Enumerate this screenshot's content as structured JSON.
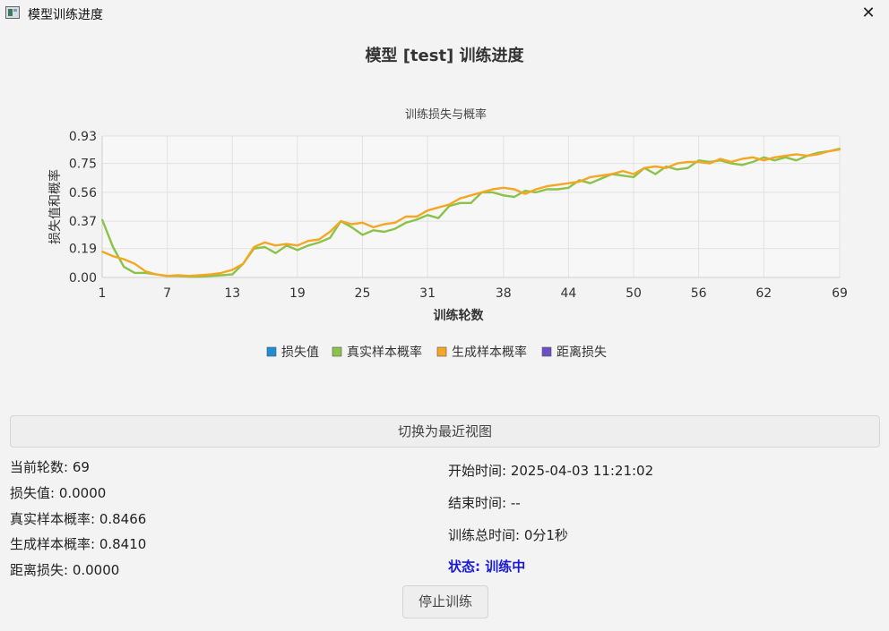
{
  "window": {
    "title": "模型训练进度",
    "close_symbol": "✕"
  },
  "heading": "模型 [test] 训练进度",
  "chart_data": {
    "type": "line",
    "title": "训练损失与概率",
    "xlabel": "训练轮数",
    "ylabel": "损失值和概率",
    "xlim": [
      1,
      69
    ],
    "ylim": [
      0,
      0.93
    ],
    "x_ticks": [
      1,
      7,
      13,
      19,
      25,
      31,
      38,
      44,
      50,
      56,
      62,
      69
    ],
    "y_ticks": [
      0.0,
      0.19,
      0.37,
      0.56,
      0.75,
      0.93
    ],
    "y_tick_labels": [
      "0.00",
      "0.19",
      "0.37",
      "0.56",
      "0.75",
      "0.93"
    ],
    "grid": true,
    "legend_position": "bottom",
    "series": [
      {
        "name": "损失值",
        "color": "#1f8dd6",
        "values": []
      },
      {
        "name": "真实样本概率",
        "color": "#8bc34a",
        "values": [
          0.38,
          0.2,
          0.07,
          0.03,
          0.03,
          0.02,
          0.01,
          0.01,
          0.005,
          0.005,
          0.01,
          0.015,
          0.02,
          0.09,
          0.19,
          0.2,
          0.16,
          0.21,
          0.18,
          0.21,
          0.23,
          0.26,
          0.37,
          0.33,
          0.28,
          0.31,
          0.3,
          0.32,
          0.36,
          0.38,
          0.41,
          0.39,
          0.47,
          0.49,
          0.49,
          0.56,
          0.56,
          0.54,
          0.53,
          0.57,
          0.56,
          0.58,
          0.58,
          0.59,
          0.64,
          0.62,
          0.65,
          0.68,
          0.67,
          0.66,
          0.72,
          0.68,
          0.73,
          0.71,
          0.72,
          0.77,
          0.76,
          0.77,
          0.75,
          0.74,
          0.76,
          0.79,
          0.77,
          0.79,
          0.77,
          0.8,
          0.82,
          0.83,
          0.8466
        ]
      },
      {
        "name": "生成样本概率",
        "color": "#f5a623",
        "values": [
          0.17,
          0.14,
          0.12,
          0.09,
          0.04,
          0.02,
          0.01,
          0.015,
          0.01,
          0.015,
          0.02,
          0.03,
          0.05,
          0.09,
          0.2,
          0.23,
          0.21,
          0.22,
          0.21,
          0.24,
          0.25,
          0.3,
          0.37,
          0.35,
          0.36,
          0.33,
          0.35,
          0.36,
          0.4,
          0.4,
          0.44,
          0.46,
          0.48,
          0.52,
          0.54,
          0.56,
          0.58,
          0.59,
          0.58,
          0.55,
          0.58,
          0.6,
          0.61,
          0.62,
          0.63,
          0.66,
          0.67,
          0.68,
          0.7,
          0.68,
          0.72,
          0.73,
          0.72,
          0.75,
          0.76,
          0.76,
          0.75,
          0.78,
          0.76,
          0.78,
          0.79,
          0.77,
          0.79,
          0.8,
          0.81,
          0.8,
          0.81,
          0.83,
          0.841
        ]
      },
      {
        "name": "距离损失",
        "color": "#6a4fc8",
        "values": []
      }
    ]
  },
  "toggle_button": "切换为最近视图",
  "stats_left": [
    "当前轮数: 69",
    "损失值: 0.0000",
    "真实样本概率: 0.8466",
    "生成样本概率: 0.8410",
    "距离损失: 0.0000"
  ],
  "stats_right": {
    "start": "开始时间: 2025-04-03 11:21:02",
    "end": "结束时间: --",
    "total": "训练总时间: 0分1秒",
    "status": "状态: 训练中"
  },
  "stop_button": "停止训练"
}
